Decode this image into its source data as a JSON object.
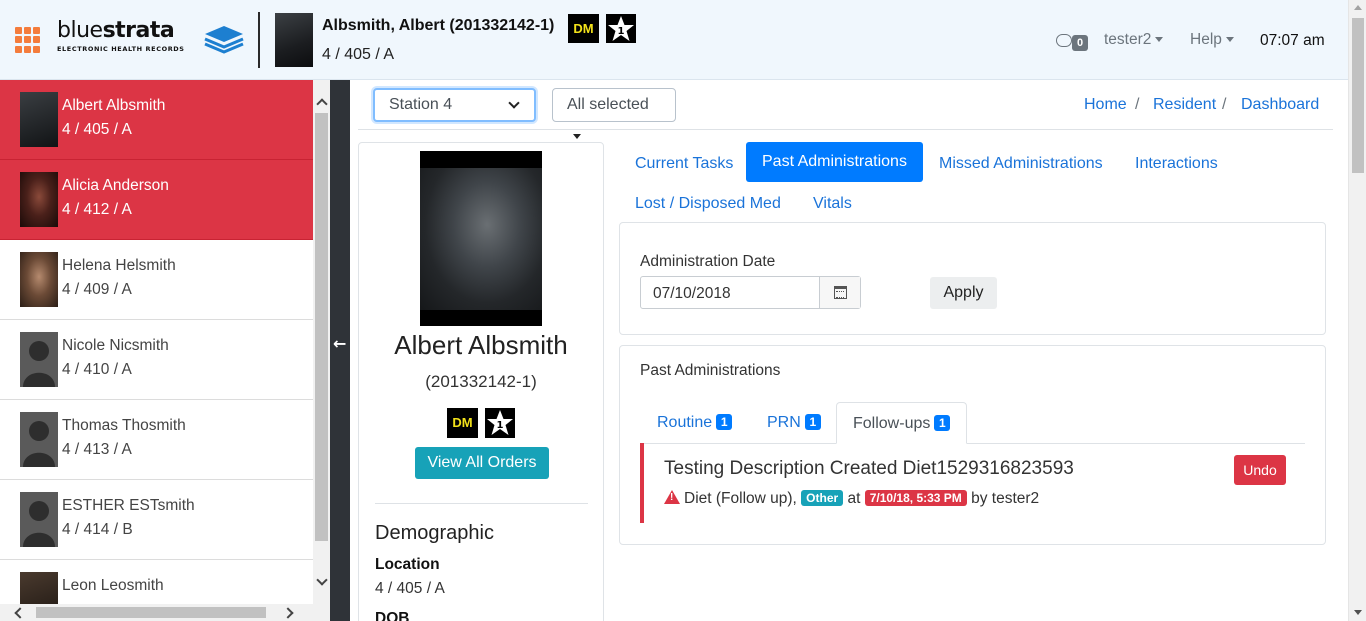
{
  "header": {
    "logo_text_regular": "blue",
    "logo_text_bold": "strata",
    "logo_subtitle": "ELECTRONIC HEALTH RECORDS",
    "resident_name": "Albsmith, Albert (201332142-1)",
    "resident_location": "4 / 405 / A",
    "badge_dm": "DM",
    "messages_count": "0",
    "user_menu": "tester2",
    "help_menu": "Help",
    "time": "07:07 am"
  },
  "sidebar": {
    "residents": [
      {
        "name": "Albert Albsmith",
        "location": "4 / 405 / A"
      },
      {
        "name": "Alicia Anderson",
        "location": "4 / 412 / A"
      },
      {
        "name": "Helena Helsmith",
        "location": "4 / 409 / A"
      },
      {
        "name": "Nicole Nicsmith",
        "location": "4 / 410 / A"
      },
      {
        "name": "Thomas Thosmith",
        "location": "4 / 413 / A"
      },
      {
        "name": "ESTHER ESTsmith",
        "location": "4 / 414 / B"
      },
      {
        "name": "Leon Leosmith",
        "location": ""
      }
    ]
  },
  "filters": {
    "station": "Station 4",
    "selection": "All selected"
  },
  "breadcrumb": {
    "items": [
      "Home",
      "Resident",
      "Dashboard"
    ],
    "separator": "/"
  },
  "profile": {
    "name": "Albert Albsmith",
    "id": "(201332142-1)",
    "badge_dm": "DM",
    "view_orders_label": "View All Orders",
    "demographic_title": "Demographic",
    "location_label": "Location",
    "location_value": "4 / 405 / A",
    "dob_label": "DOB"
  },
  "tabs": [
    "Current Tasks",
    "Past Administrations",
    "Missed Administrations",
    "Interactions",
    "Lost / Disposed Med",
    "Vitals"
  ],
  "date_filter": {
    "label": "Administration Date",
    "value": "07/10/2018",
    "apply_label": "Apply"
  },
  "past_admin": {
    "title": "Past Administrations",
    "subtabs": [
      {
        "label": "Routine",
        "count": "1"
      },
      {
        "label": "PRN",
        "count": "1"
      },
      {
        "label": "Follow-ups",
        "count": "1"
      }
    ],
    "entry": {
      "title": "Testing Description Created Diet1529316823593",
      "type": "Diet (Follow up),",
      "tag": "Other",
      "at": "at",
      "datetime": "7/10/18, 5:33 PM",
      "by": "by tester2",
      "undo_label": "Undo"
    }
  },
  "colors": {
    "accent": "#007bff",
    "danger": "#dc3545",
    "info": "#17a2b8",
    "header_bg": "#f0f7fd",
    "sidebar_dark": "#2f3338"
  },
  "icons": [
    "apps-grid-icon",
    "stack-logo-icon",
    "star-badge-icon",
    "chat-icon",
    "calendar-icon",
    "warning-icon",
    "arrow-left-icon"
  ]
}
